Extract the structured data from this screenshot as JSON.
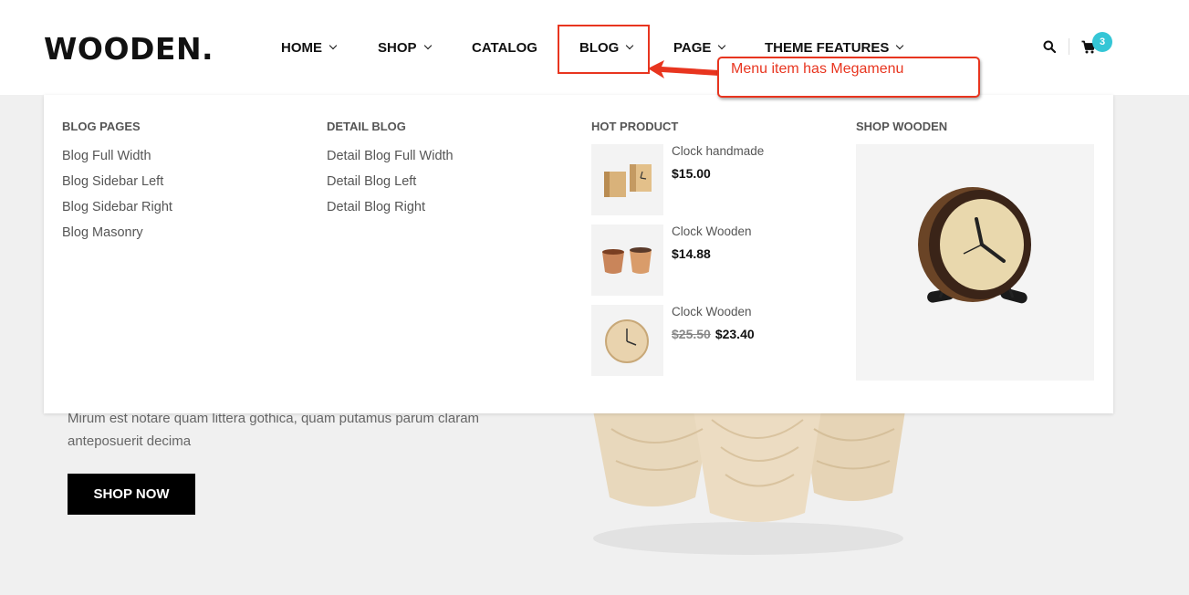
{
  "header": {
    "logo": "WOODEN.",
    "nav": [
      {
        "label": "HOME"
      },
      {
        "label": "SHOP"
      },
      {
        "label": "CATALOG"
      },
      {
        "label": "BLOG"
      },
      {
        "label": "PAGE"
      },
      {
        "label": "THEME FEATURES"
      }
    ],
    "cart_count": "3",
    "search_icon": "search-icon",
    "cart_icon": "cart-icon"
  },
  "annotation": {
    "text": "Menu item has Megamenu",
    "color": "#e8351f"
  },
  "megamenu": {
    "blog_pages": {
      "title": "BLOG PAGES",
      "links": [
        "Blog Full Width",
        "Blog Sidebar Left",
        "Blog Sidebar Right",
        "Blog Masonry"
      ]
    },
    "detail_blog": {
      "title": "DETAIL BLOG",
      "links": [
        "Detail Blog Full Width",
        "Detail Blog Left",
        "Detail Blog Right"
      ]
    },
    "hot_product": {
      "title": "HOT PRODUCT",
      "products": [
        {
          "name": "Clock handmade",
          "price": "$15.00",
          "old_price": ""
        },
        {
          "name": "Clock Wooden",
          "price": "$14.88",
          "old_price": ""
        },
        {
          "name": "Clock Wooden",
          "price": "$23.40",
          "old_price": "$25.50"
        }
      ]
    },
    "shop_wooden": {
      "title": "SHOP WOODEN"
    }
  },
  "hero": {
    "text_line1": "Mirum est notare quam littera gothica, quam putamus parum claram",
    "text_line2": "anteposuerit decima",
    "button": "SHOP NOW"
  },
  "colors": {
    "accent": "#35c6d6",
    "annotation": "#e8351f"
  }
}
